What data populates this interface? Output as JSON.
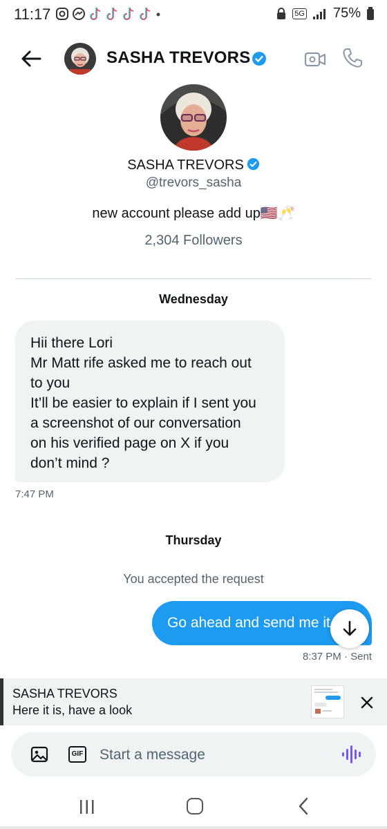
{
  "status_bar": {
    "time": "11:17",
    "network": "5G",
    "battery": "75%",
    "notification_icons": [
      "instagram-icon",
      "messenger-icon",
      "tiktok-icon",
      "tiktok-icon",
      "tiktok-icon",
      "tiktok-icon"
    ]
  },
  "header": {
    "name": "SASHA TREVORS",
    "verified": true
  },
  "profile": {
    "name": "SASHA TREVORS",
    "handle": "@trevors_sasha",
    "bio": "new account please add up🇺🇸🥂",
    "followers": "2,304 Followers"
  },
  "conversation": {
    "day1": "Wednesday",
    "incoming": {
      "lines": [
        "Hii there Lori",
        "Mr Matt rife asked me to reach out",
        "to you",
        "It’ll be easier to explain if I sent you",
        "a screenshot of our conversation",
        "on his verified page on X if you",
        "don’t mind ?"
      ],
      "time": "7:47 PM"
    },
    "day2": "Thursday",
    "system_message": "You accepted the request",
    "outgoing": {
      "text": "Go ahead and send me it",
      "time": "8:37 PM · Sent"
    }
  },
  "reply_preview": {
    "name": "SASHA TREVORS",
    "text": "Here it is, have a look"
  },
  "composer": {
    "placeholder": "Start a message",
    "gif_label": "GIF"
  },
  "colors": {
    "accent": "#1d9bf0",
    "bubble_in": "#eff3f4",
    "text_secondary": "#536471",
    "voice": "#7856ff"
  }
}
